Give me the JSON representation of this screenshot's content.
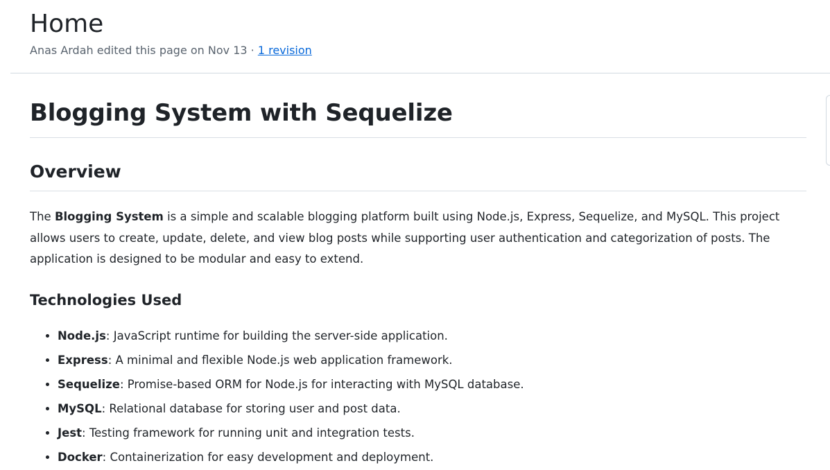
{
  "header": {
    "title": "Home",
    "edit_info": "Anas Ardah edited this page on Nov 13 · ",
    "revision_link": "1 revision"
  },
  "content": {
    "h1": "Blogging System with Sequelize",
    "overview": {
      "heading": "Overview",
      "intro_prefix": "The ",
      "intro_bold": "Blogging System",
      "intro_rest": " is a simple and scalable blogging platform built using Node.js, Express, Sequelize, and MySQL. This project allows users to create, update, delete, and view blog posts while supporting user authentication and categorization of posts. The application is designed to be modular and easy to extend."
    },
    "technologies": {
      "heading": "Technologies Used",
      "items": [
        {
          "name": "Node.js",
          "desc": ": JavaScript runtime for building the server-side application."
        },
        {
          "name": "Express",
          "desc": ": A minimal and flexible Node.js web application framework."
        },
        {
          "name": "Sequelize",
          "desc": ": Promise-based ORM for Node.js for interacting with MySQL database."
        },
        {
          "name": "MySQL",
          "desc": ": Relational database for storing user and post data."
        },
        {
          "name": "Jest",
          "desc": ": Testing framework for running unit and integration tests."
        },
        {
          "name": "Docker",
          "desc": ": Containerization for easy development and deployment."
        }
      ]
    }
  }
}
